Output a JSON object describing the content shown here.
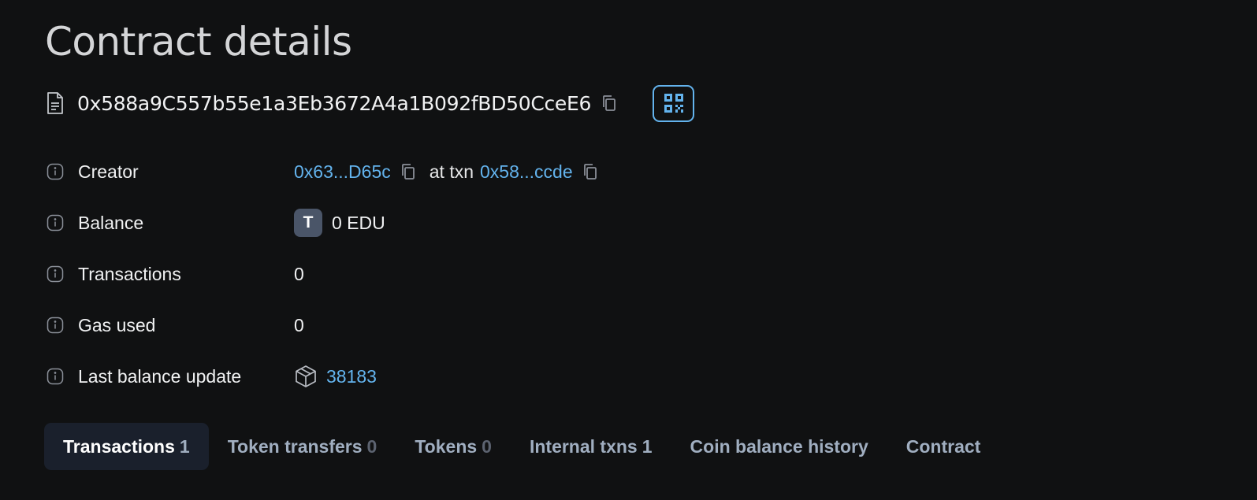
{
  "page": {
    "title": "Contract details"
  },
  "address": {
    "value": "0x588a9C557b55e1a3Eb3672A4a1B092fBD50CceE6",
    "icons": {
      "doc": "file-document-icon",
      "copy": "copy-icon",
      "qr": "qr-code-icon"
    }
  },
  "details": {
    "creator": {
      "label": "Creator",
      "address": "0x63...D65c",
      "at_txn_text": "at txn",
      "txn": "0x58...ccde"
    },
    "balance": {
      "label": "Balance",
      "token_letter": "T",
      "value": "0 EDU"
    },
    "transactions": {
      "label": "Transactions",
      "value": "0"
    },
    "gas_used": {
      "label": "Gas used",
      "value": "0"
    },
    "last_balance_update": {
      "label": "Last balance update",
      "block": "38183"
    }
  },
  "tabs": [
    {
      "label": "Transactions",
      "count": "1",
      "active": true
    },
    {
      "label": "Token transfers",
      "count": "0",
      "active": false
    },
    {
      "label": "Tokens",
      "count": "0",
      "active": false
    },
    {
      "label": "Internal txns",
      "count": "1",
      "active": false
    },
    {
      "label": "Coin balance history",
      "count": "",
      "active": false
    },
    {
      "label": "Contract",
      "count": "",
      "active": false
    }
  ],
  "colors": {
    "background": "#101112",
    "link": "#63b3ed",
    "active_tab_bg": "#1a202c",
    "inactive_tab_text": "#a0aec0"
  }
}
